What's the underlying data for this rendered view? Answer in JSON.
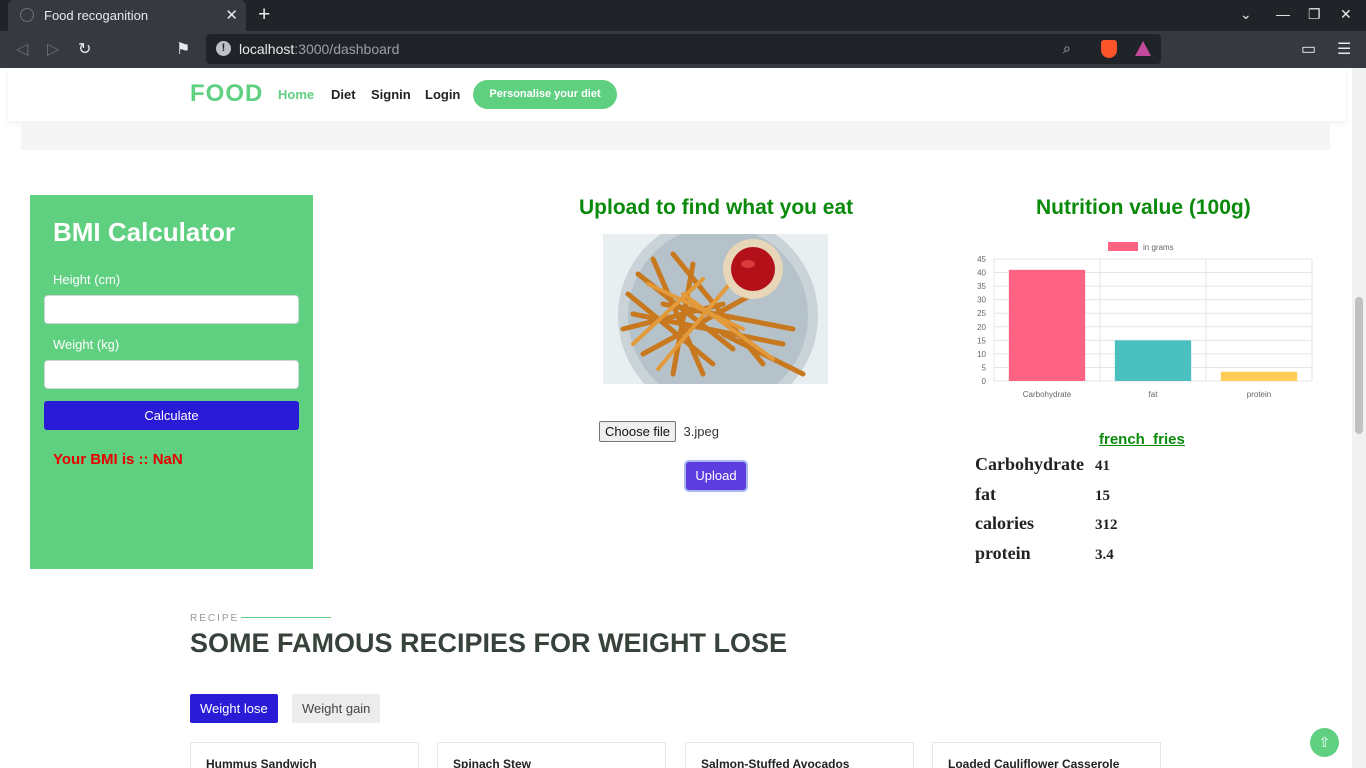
{
  "browser": {
    "tab_title": "Food recoganition",
    "url_host": "localhost",
    "url_path": ":3000/dashboard"
  },
  "header": {
    "logo": "FOOD",
    "nav": [
      "Home",
      "Diet",
      "Signin",
      "Login"
    ],
    "cta": "Personalise your diet"
  },
  "bmi": {
    "title": "BMI Calculator",
    "height_label": "Height (cm)",
    "weight_label": "Weight (kg)",
    "calculate": "Calculate",
    "result": "Your BMI is :: NaN"
  },
  "upload": {
    "title": "Upload to find what you eat",
    "choose_file": "Choose file",
    "file_name": "3.jpeg",
    "upload_button": "Upload"
  },
  "nutrition": {
    "title": "Nutrition value (100g)",
    "food": "french_fries",
    "rows": [
      {
        "name": "Carbohydrate",
        "value": "41"
      },
      {
        "name": "fat",
        "value": "15"
      },
      {
        "name": "calories",
        "value": "312"
      },
      {
        "name": "protein",
        "value": "3.4"
      }
    ]
  },
  "chart_data": {
    "type": "bar",
    "categories": [
      "Carbohydrate",
      "fat",
      "protein"
    ],
    "series": [
      {
        "name": "in grams",
        "values": [
          41,
          15,
          3.4
        ]
      }
    ],
    "ylim": [
      0,
      45
    ],
    "yticks": [
      0,
      5,
      10,
      15,
      20,
      25,
      30,
      35,
      40,
      45
    ],
    "colors": [
      "#ff6384",
      "#4bc0c0",
      "#ffcd56"
    ],
    "legend": "top",
    "grid": true
  },
  "recipes": {
    "tag": "RECIPE",
    "heading": "SOME FAMOUS RECIPIES FOR WEIGHT LOSE",
    "tabs": [
      "Weight lose",
      "Weight gain"
    ],
    "cards": [
      "Hummus Sandwich",
      "Spinach Stew",
      "Salmon-Stuffed Avocados",
      "Loaded Cauliflower Casserole"
    ]
  }
}
